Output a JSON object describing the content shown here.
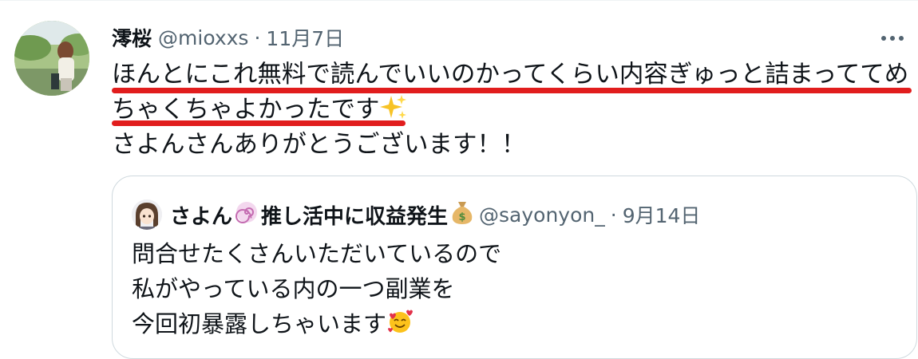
{
  "tweet": {
    "author_name": "澪桜",
    "author_handle": "@mioxxs",
    "separator": "·",
    "date": "11月7日",
    "lines": [
      "ほんとにこれ無料で読んでいいのかってくらい内容ぎゅっと詰まっててめ",
      "ちゃくちゃよかったです",
      "さよんさんありがとうございます！！"
    ],
    "line2_emoji": "sparkles-emoji",
    "highlight_color": "#e11d1d"
  },
  "quote": {
    "author_name_part1": "さよん",
    "author_name_emoji1": "swirl-emoji",
    "author_name_part2": "推し活中に収益発生",
    "author_name_emoji2": "money-bag-emoji",
    "author_handle": "@sayonyon_",
    "separator": "·",
    "date": "9月14日",
    "lines": [
      "問合せたくさんいただいているので",
      "私がやっている内の一つ副業を",
      "今回初暴露しちゃいます"
    ],
    "line3_emoji": "smiling-face-with-hearts-emoji"
  },
  "icons": {
    "more": "more-horizontal-icon"
  },
  "colors": {
    "text": "#0f1419",
    "secondary": "#536471",
    "border": "#cfd9de",
    "underline": "#e11d1d"
  }
}
